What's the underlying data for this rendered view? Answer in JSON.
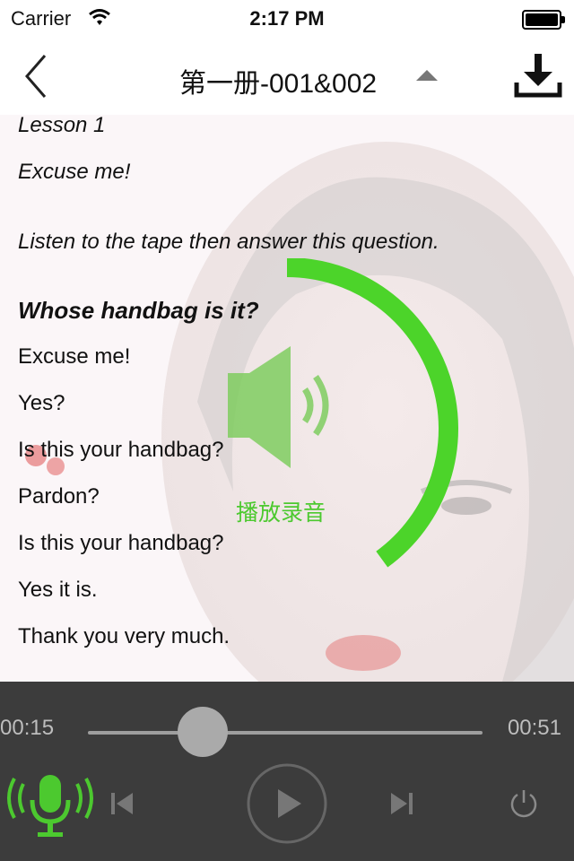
{
  "status_bar": {
    "carrier": "Carrier",
    "time": "2:17 PM"
  },
  "nav": {
    "title": "第一册-001&002"
  },
  "lesson": {
    "lines": [
      "Lesson 1",
      "Excuse me!",
      "Listen to the tape then answer this question.",
      "Whose handbag is it?",
      "Excuse me!",
      "Yes?",
      "Is this your handbag?",
      "Pardon?",
      "Is this your handbag?",
      "Yes it is.",
      "Thank you very much."
    ]
  },
  "overlay": {
    "label": "播放录音",
    "progress": 0.4,
    "color": "#4cd42a"
  },
  "player": {
    "current_time": "00:15",
    "total_time": "00:51",
    "progress": 0.29,
    "mic_color": "#4cc92f"
  },
  "icons": [
    "back-chevron-icon",
    "caret-up-icon",
    "download-icon",
    "speaker-icon",
    "microphone-icon",
    "previous-icon",
    "play-icon",
    "next-icon",
    "power-icon"
  ]
}
